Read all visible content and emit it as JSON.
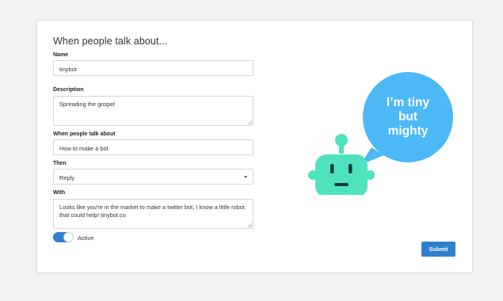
{
  "form": {
    "title": "When people talk about...",
    "name": {
      "label": "Name",
      "value": "tinybot"
    },
    "description": {
      "label": "Description",
      "value": "Spreading the gospel"
    },
    "topic": {
      "label": "When people talk about",
      "value": "How to make a bot"
    },
    "then": {
      "label": "Then",
      "selected": "Reply"
    },
    "with": {
      "label": "With",
      "value": "Looks like you're in the market to make a twitter bot, I know a little robot that could help! tinybot.co"
    },
    "active": {
      "label": "Active",
      "on": true
    },
    "submit_label": "Submit"
  },
  "illustration": {
    "speech_bubble_lines": [
      "I’m tiny",
      "but",
      "mighty"
    ],
    "bubble_color": "#4cb8f5",
    "robot_color": "#4fe3bd"
  },
  "colors": {
    "accent": "#2f7fd0",
    "background": "#f1f1f1",
    "card": "#ffffff"
  }
}
